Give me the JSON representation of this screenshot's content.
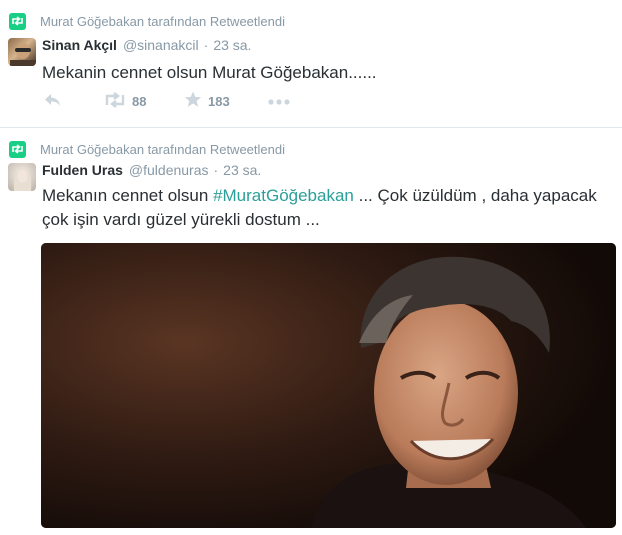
{
  "tweets": [
    {
      "context": "Murat Göğebakan tarafından Retweetlendi",
      "fullname": "Sinan Akçıl",
      "username": "@sinanakcil",
      "separator": "·",
      "time": "23 sa.",
      "text": "Mekanin cennet olsun Murat Göğebakan......",
      "retweet_count": "88",
      "favorite_count": "183",
      "icons": [
        "retweet-icon",
        "reply-icon",
        "favorite-icon",
        "more-icon"
      ],
      "colors": {
        "retweet_badge": "#19cf86",
        "action_icon": "#ccd6dd"
      }
    },
    {
      "context": "Murat Göğebakan tarafından Retweetlendi",
      "fullname": "Fulden Uras",
      "username": "@fuldenuras",
      "separator": "·",
      "time": "23 sa.",
      "text_before": "Mekanın cennet olsun ",
      "hashtag": "#MuratGöğebakan",
      "text_after": " ... Çok üzüldüm , daha yapacak çok işin vardı güzel yürekli dostum ...",
      "colors": {
        "hashtag": "#2b9f98"
      }
    }
  ]
}
